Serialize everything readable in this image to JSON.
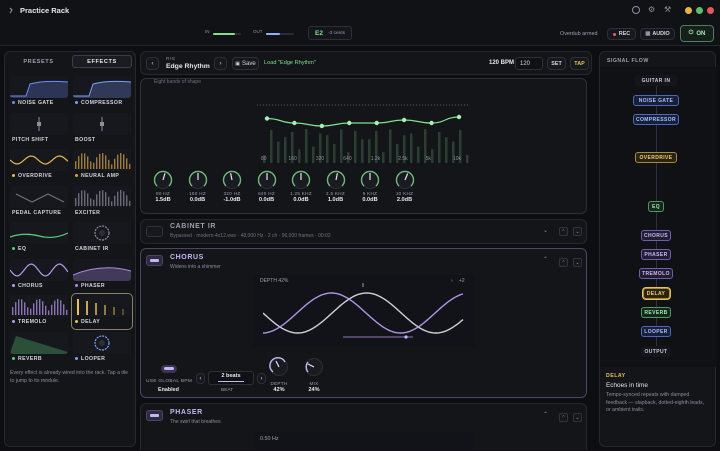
{
  "app": {
    "title": "Practice Rack"
  },
  "top": {
    "in_label": "IN",
    "out_label": "OUT",
    "note": "E2",
    "cents": "-3 cents",
    "overdub": "Overdub armed",
    "rec": "REC",
    "audio": "AUDIO",
    "power": "ON"
  },
  "left": {
    "tab_presets": "PRESETS",
    "tab_effects": "EFFECTS",
    "tiles": [
      {
        "label": "NOISE GATE",
        "color": "#6b8cff"
      },
      {
        "label": "COMPRESSOR",
        "color": "#7aa0ff"
      },
      {
        "label": "PITCH SHIFT",
        "color": ""
      },
      {
        "label": "BOOST",
        "color": ""
      },
      {
        "label": "OVERDRIVE",
        "color": "#e8b84a"
      },
      {
        "label": "NEURAL AMP",
        "color": "#d9a541"
      },
      {
        "label": "PEDAL CAPTURE",
        "color": ""
      },
      {
        "label": "EXCITER",
        "color": ""
      },
      {
        "label": "EQ",
        "color": "#58d27a"
      },
      {
        "label": "CABINET IR",
        "color": ""
      },
      {
        "label": "CHORUS",
        "color": "#b89af0"
      },
      {
        "label": "PHASER",
        "color": "#a88be8"
      },
      {
        "label": "TREMOLO",
        "color": "#b89af0"
      },
      {
        "label": "DELAY",
        "color": "#e8c15a"
      },
      {
        "label": "REVERB",
        "color": "#58d27a"
      },
      {
        "label": "LOOPER",
        "color": "#7aa0ff"
      }
    ],
    "hint": "Every effect is already wired into the rack. Tap a tile to jump to its module."
  },
  "rig": {
    "label": "RIG",
    "name": "Edge Rhythm",
    "save": "Save",
    "status": "Load \"Edge Rhythm\"",
    "bpm_label": "120 BPM",
    "bpm_value": "120",
    "set": "SET",
    "tap": "TAP"
  },
  "eq": {
    "subtitle": "Eight bands of shape",
    "freq_labels": [
      "80",
      "160",
      "320",
      "640",
      "1.2k",
      "2.5k",
      "5k",
      "10k"
    ],
    "gains_db": [
      1.5,
      0.0,
      -1.0,
      0.0,
      0.0,
      1.0,
      0.0,
      2.0
    ],
    "knobs": [
      {
        "label": "80 HZ",
        "value": "1.5dB"
      },
      {
        "label": "160 HZ",
        "value": "0.0dB"
      },
      {
        "label": "320 HZ",
        "value": "-1.0dB"
      },
      {
        "label": "640 HZ",
        "value": "0.0dB"
      },
      {
        "label": "1.25 KHZ",
        "value": "0.0dB"
      },
      {
        "label": "2.5 KHZ",
        "value": "1.0dB"
      },
      {
        "label": "5 KHZ",
        "value": "0.0dB"
      },
      {
        "label": "10 KHZ",
        "value": "2.0dB"
      }
    ]
  },
  "cabinet": {
    "title": "CABINET IR",
    "info": "Bypassed · modern-4x12.wav · 48,000 Hz · 2 ch · 96,000 frames · 00:02"
  },
  "chorus": {
    "title": "CHORUS",
    "subtitle": "Widens into a shimmer",
    "depth_label": "DEPTH 42%",
    "voices": "+2",
    "global_bpm_label": "USE GLOBAL BPM",
    "global_bpm_value": "Enabled",
    "beat_value": "2 beats",
    "beat_label": "BEAT",
    "depth_knob_label": "DEPTH",
    "depth_knob_value": "42%",
    "mix_knob_label": "MIX",
    "mix_knob_value": "24%"
  },
  "phaser": {
    "title": "PHASER",
    "subtitle": "The swirl that breathes",
    "rate": "0.50 Hz"
  },
  "signal_flow": {
    "title": "SIGNAL FLOW",
    "nodes": [
      {
        "label": "GUITAR IN",
        "state": "plain"
      },
      {
        "label": "NOISE GATE",
        "state": "blue"
      },
      {
        "label": "COMPRESSOR",
        "state": "blue"
      },
      {
        "label": "OVERDRIVE",
        "state": "amber"
      },
      {
        "label": "EQ",
        "state": "green"
      },
      {
        "label": "CHORUS",
        "state": "violet"
      },
      {
        "label": "PHASER",
        "state": "violet"
      },
      {
        "label": "TREMOLO",
        "state": "violet"
      },
      {
        "label": "DELAY",
        "state": "amber"
      },
      {
        "label": "REVERB",
        "state": "green"
      },
      {
        "label": "LOOPER",
        "state": "blue"
      },
      {
        "label": "OUTPUT",
        "state": "plain"
      }
    ],
    "info_title": "DELAY",
    "info_heading": "Echoes in time",
    "info_text": "Tempo-synced repeats with damped feedback — slapback, dotted-eighth leads, or ambient trails."
  }
}
